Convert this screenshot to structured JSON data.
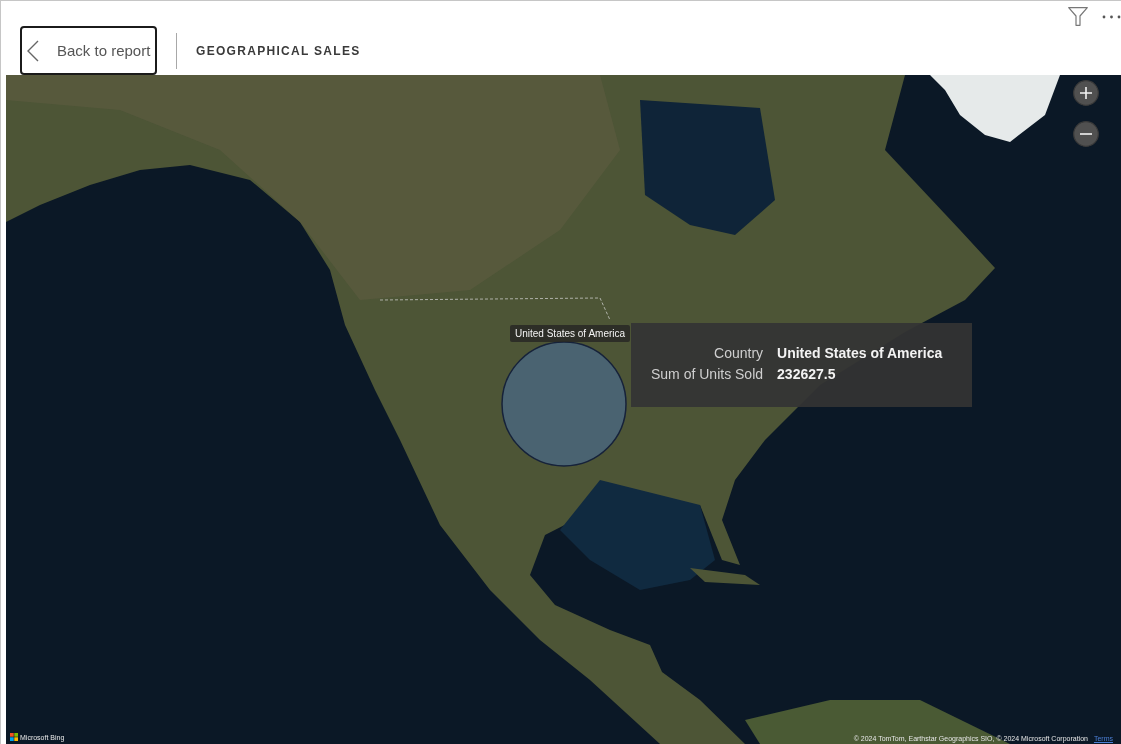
{
  "header": {
    "back_button": "Back to report",
    "title": "GEOGRAPHICAL SALES"
  },
  "map": {
    "bubble_label": "United States of America",
    "tooltip": {
      "rows": [
        {
          "label": "Country",
          "value": "United States of America"
        },
        {
          "label": "Sum of Units Sold",
          "value": "232627.5"
        }
      ]
    },
    "logo": "Microsoft Bing",
    "attribution": "© 2024 TomTom, Earthstar Geographics SIO, © 2024 Microsoft Corporation",
    "terms_link": "Terms"
  }
}
